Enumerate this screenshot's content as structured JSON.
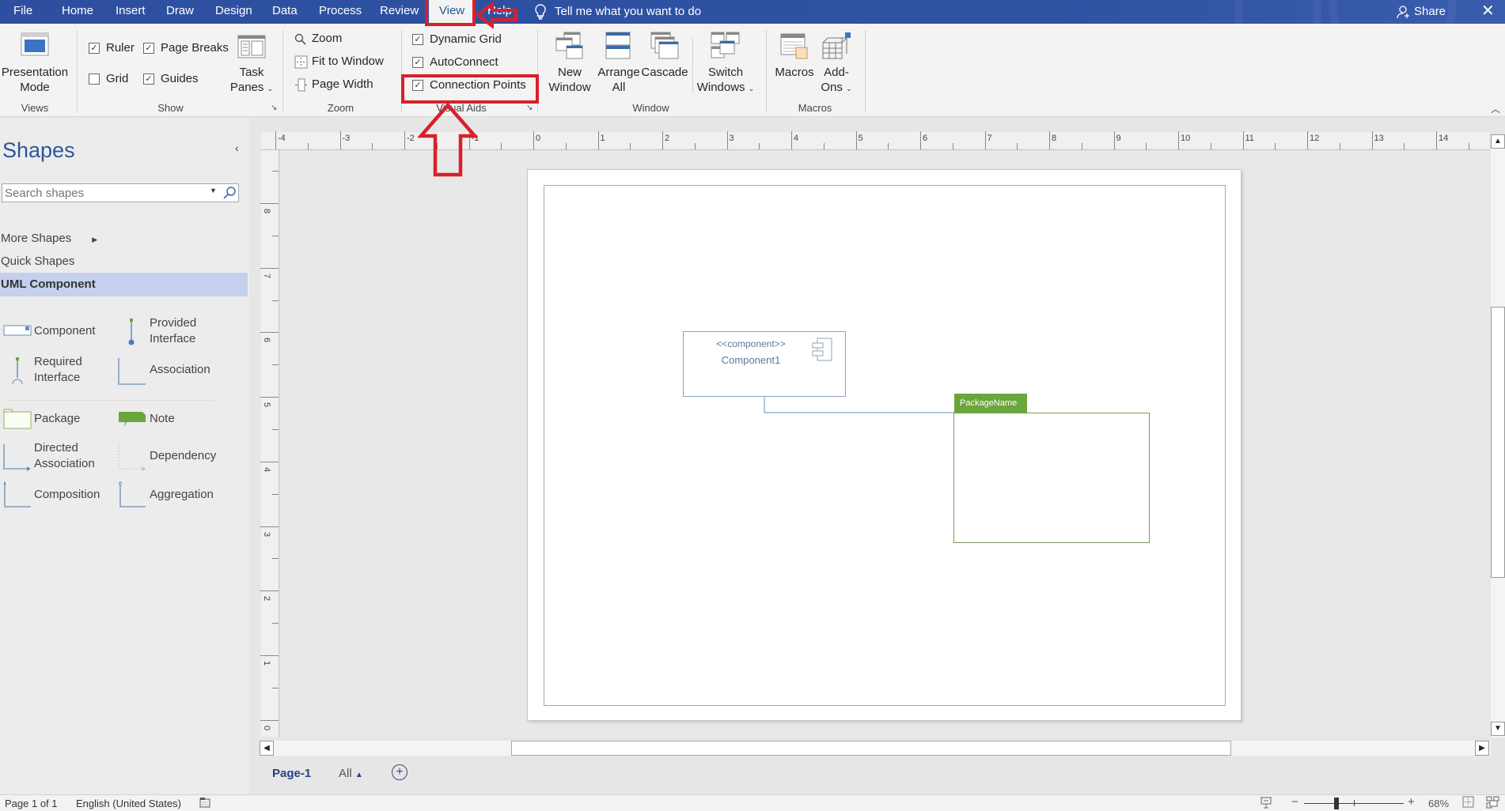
{
  "tabs": [
    {
      "label": "File",
      "active": false
    },
    {
      "label": "Home",
      "active": false
    },
    {
      "label": "Insert",
      "active": false
    },
    {
      "label": "Draw",
      "active": false
    },
    {
      "label": "Design",
      "active": false
    },
    {
      "label": "Data",
      "active": false
    },
    {
      "label": "Process",
      "active": false
    },
    {
      "label": "Review",
      "active": false
    },
    {
      "label": "View",
      "active": true
    },
    {
      "label": "Help",
      "active": false
    }
  ],
  "tell_me": "Tell me what you want to do",
  "share_label": "Share",
  "ribbon": {
    "views": {
      "group_label": "Views",
      "presentation_mode": "Presentation Mode"
    },
    "show": {
      "group_label": "Show",
      "ruler": {
        "label": "Ruler",
        "checked": true
      },
      "page_breaks": {
        "label": "Page Breaks",
        "checked": true
      },
      "grid": {
        "label": "Grid",
        "checked": false
      },
      "guides": {
        "label": "Guides",
        "checked": true
      },
      "task_panes": "Task Panes"
    },
    "zoom": {
      "group_label": "Zoom",
      "zoom": "Zoom",
      "fit_to_window": "Fit to Window",
      "page_width": "Page Width"
    },
    "visual_aids": {
      "group_label": "Visual Aids",
      "dynamic_grid": {
        "label": "Dynamic Grid",
        "checked": true
      },
      "autoconnect": {
        "label": "AutoConnect",
        "checked": true
      },
      "connection_points": {
        "label": "Connection Points",
        "checked": true
      }
    },
    "window": {
      "group_label": "Window",
      "new_window": "New Window",
      "arrange_all": "Arrange All",
      "cascade": "Cascade",
      "switch_windows": "Switch Windows"
    },
    "macros": {
      "group_label": "Macros",
      "macros": "Macros",
      "add_ons": "Add-Ons"
    }
  },
  "shapes_pane": {
    "title": "Shapes",
    "search_placeholder": "Search shapes",
    "more_shapes": "More Shapes",
    "quick_shapes": "Quick Shapes",
    "active_stencil": "UML Component",
    "stencil_items": [
      {
        "label": "Component",
        "icon": "component-shape-icon"
      },
      {
        "label": "Provided Interface",
        "icon": "provided-interface-icon"
      },
      {
        "label": "Required Interface",
        "icon": "required-interface-icon"
      },
      {
        "label": "Association",
        "icon": "association-icon"
      },
      {
        "label": "Package",
        "icon": "package-shape-icon"
      },
      {
        "label": "Note",
        "icon": "note-shape-icon"
      },
      {
        "label": "Directed Association",
        "icon": "directed-association-icon"
      },
      {
        "label": "Dependency",
        "icon": "dependency-icon"
      },
      {
        "label": "Composition",
        "icon": "composition-icon"
      },
      {
        "label": "Aggregation",
        "icon": "aggregation-icon"
      }
    ]
  },
  "rulers": {
    "horizontal": [
      "-4",
      "-3",
      "-2",
      "-1",
      "0",
      "1",
      "2",
      "3",
      "4",
      "5",
      "6",
      "7",
      "8",
      "9",
      "10",
      "11",
      "12",
      "13",
      "14"
    ],
    "vertical": [
      "8",
      "7",
      "6",
      "5",
      "4",
      "3",
      "2",
      "1",
      "0"
    ]
  },
  "diagram": {
    "component": {
      "stereotype": "<<component>>",
      "name": "Component1"
    },
    "package": {
      "name": "PackageName"
    }
  },
  "page_tabs": {
    "current": "Page-1",
    "all": "All"
  },
  "status": {
    "page": "Page 1 of 1",
    "language": "English (United States)",
    "zoom_percent": "68%",
    "zoom_level": 68
  },
  "colors": {
    "brand_blue": "#2b579a",
    "annotation_red": "#d8202a",
    "package_green": "#6aa63c"
  }
}
